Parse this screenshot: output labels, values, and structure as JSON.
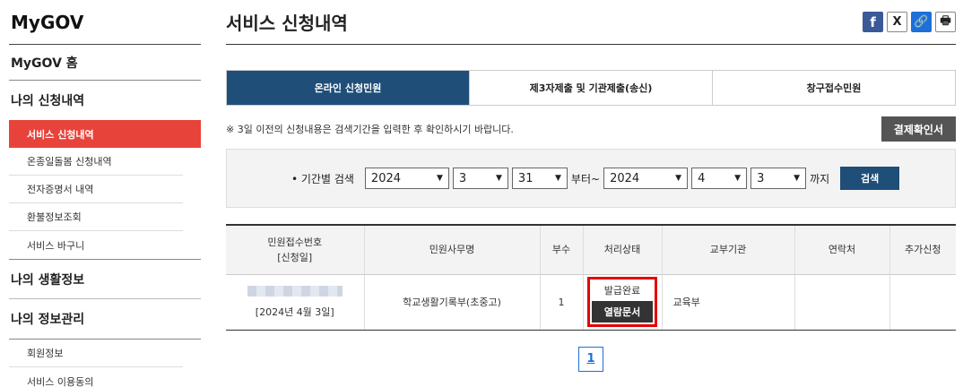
{
  "sidebar": {
    "brand": "MyGOV",
    "home": "MyGOV 홈",
    "sections": [
      {
        "title": "나의 신청내역",
        "items": [
          "서비스 신청내역",
          "온종일돌봄 신청내역",
          "전자증명서 내역",
          "환불정보조회",
          "서비스 바구니"
        ]
      },
      {
        "title": "나의 생활정보",
        "items": []
      },
      {
        "title": "나의 정보관리",
        "items": [
          "회원정보",
          "서비스 이용동의"
        ]
      }
    ]
  },
  "main": {
    "title": "서비스 신청내역",
    "share": {
      "facebook": "f",
      "x": "X",
      "link": "🔗",
      "print": "🖶"
    },
    "tabs": [
      "온라인 신청민원",
      "제3자제출 및 기관제출(송신)",
      "창구접수민원"
    ],
    "notice": "※ 3일 이전의 신청내용은 검색기간을 입력한 후 확인하시기 바랍니다.",
    "confirm_button": "결제확인서",
    "search": {
      "label": "• 기간별 검색",
      "from_year": "2024",
      "from_month": "3",
      "from_day": "31",
      "from_suffix": "부터~",
      "to_year": "2024",
      "to_month": "4",
      "to_day": "3",
      "to_suffix": "까지",
      "button": "검색"
    },
    "table": {
      "headers": [
        "민원접수번호\n[신청일]",
        "민원사무명",
        "부수",
        "처리상태",
        "교부기관",
        "연락처",
        "추가신청"
      ],
      "header_line1": "민원접수번호",
      "header_line2": "[신청일]",
      "row": {
        "date": "[2024년 4월 3일]",
        "name": "학교생활기록부(초중고)",
        "copies": "1",
        "status": "발급완료",
        "view_button": "열람문서",
        "agency": "교육부",
        "contact": "",
        "extra": ""
      }
    },
    "pager": {
      "current": "1"
    }
  }
}
